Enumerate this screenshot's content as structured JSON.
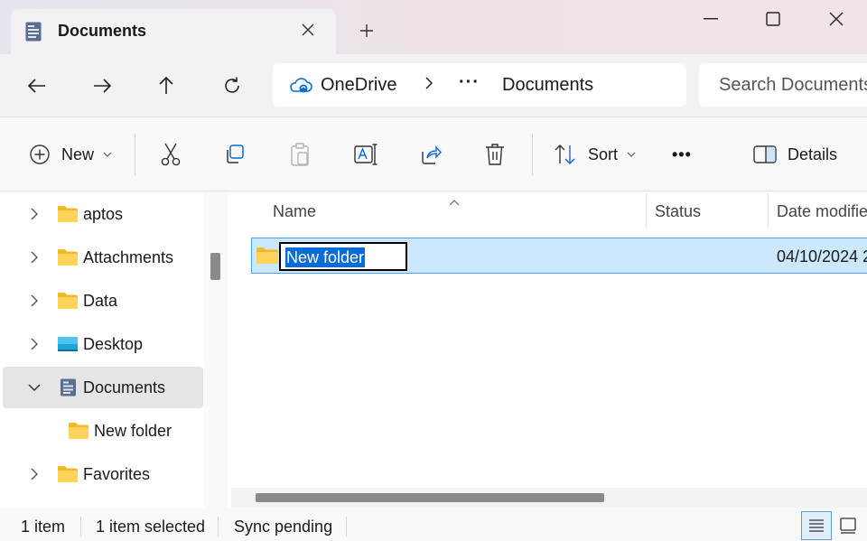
{
  "window": {
    "tab_title": "Documents",
    "new_tab_symbol": "+",
    "controls": [
      "minimize",
      "maximize",
      "close"
    ]
  },
  "address_bar": {
    "root": "OneDrive",
    "overflow": "···",
    "current": "Documents",
    "search_placeholder": "Search Documents"
  },
  "toolbar": {
    "new_label": "New",
    "sort_label": "Sort",
    "more_label": "•••",
    "details_label": "Details",
    "actions": [
      "cut-icon",
      "copy-icon",
      "paste-icon",
      "rename-icon",
      "share-icon",
      "delete-icon"
    ]
  },
  "sidebar": {
    "items": [
      {
        "label": "aptos",
        "icon": "folder-icon"
      },
      {
        "label": "Attachments",
        "icon": "folder-icon"
      },
      {
        "label": "Data",
        "icon": "folder-icon"
      },
      {
        "label": "Desktop",
        "icon": "desktop-icon"
      },
      {
        "label": "Documents",
        "icon": "documents-icon",
        "expanded": true,
        "selected": true
      },
      {
        "label": "New folder",
        "icon": "folder-icon",
        "child": true
      },
      {
        "label": "Favorites",
        "icon": "folder-icon"
      }
    ]
  },
  "columns": {
    "name": "Name",
    "status": "Status",
    "date_modified": "Date modified"
  },
  "files": [
    {
      "name": "New folder",
      "status": "",
      "date_modified": "04/10/2024 2",
      "renaming": true,
      "selected": true
    }
  ],
  "status_bar": {
    "count": "1 item",
    "selected": "1 item selected",
    "sync": "Sync pending"
  },
  "colors": {
    "accent": "#0a6cd6",
    "selection_bg": "#cce8ff",
    "folder": "#f5c542"
  }
}
